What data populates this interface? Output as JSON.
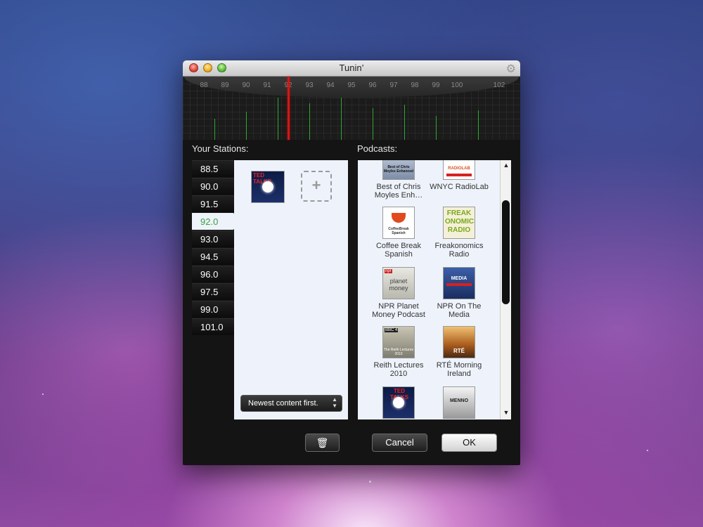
{
  "window": {
    "title": "Tunin’"
  },
  "tuner": {
    "frequencies": [
      "88",
      "89",
      "90",
      "91",
      "92",
      "93",
      "94",
      "95",
      "96",
      "97",
      "98",
      "99",
      "100",
      "102"
    ],
    "selected_frequency": "92.0"
  },
  "stations": {
    "label": "Your Stations:",
    "items": [
      {
        "freq": "88.5"
      },
      {
        "freq": "90.0"
      },
      {
        "freq": "91.5"
      },
      {
        "freq": "92.0"
      },
      {
        "freq": "93.0"
      },
      {
        "freq": "94.5"
      },
      {
        "freq": "96.0"
      },
      {
        "freq": "97.5"
      },
      {
        "freq": "99.0"
      },
      {
        "freq": "101.0"
      }
    ],
    "selected_index": 3,
    "sort_option": "Newest content first.",
    "add_symbol": "+"
  },
  "podcasts": {
    "label": "Podcasts:",
    "items": [
      {
        "name": "Best of Chris Moyles Enh…",
        "icon": "chris-moyles-art",
        "art_text": "Best of Chris Moyles Enhanced"
      },
      {
        "name": "WNYC RadioLab",
        "icon": "radiolab-art",
        "art_text": "RADIOLAB"
      },
      {
        "name": "Coffee Break Spanish",
        "icon": "coffee-break-art",
        "art_text": "CoffeeBreak Spanish"
      },
      {
        "name": "Freakonomics Radio",
        "icon": "freakonomics-art",
        "art_text": "FREAK ONOMICS RADIO"
      },
      {
        "name": "NPR Planet Money Podcast",
        "icon": "planet-money-art",
        "art_text": "planet money"
      },
      {
        "name": "NPR On The Media",
        "icon": "on-the-media-art",
        "art_text": "MEDIA"
      },
      {
        "name": "Reith Lectures 2010",
        "icon": "reith-art",
        "art_text": "The Reith Lectures 2010"
      },
      {
        "name": "RTÉ Morning Ireland",
        "icon": "rte-art",
        "art_text": "RTÉ"
      },
      {
        "name": "",
        "icon": "ted-talks-art",
        "art_text": "TED TALKS"
      },
      {
        "name": "",
        "icon": "menno-art",
        "art_text": "MENNO"
      }
    ]
  },
  "buttons": {
    "cancel": "Cancel",
    "ok": "OK"
  },
  "colors": {
    "accent_green": "#3aa040",
    "needle_red": "#d11818"
  }
}
